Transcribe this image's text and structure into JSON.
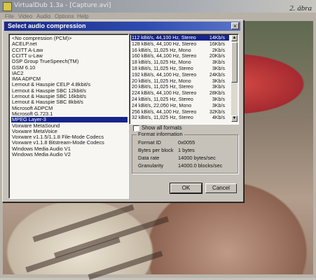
{
  "background_window": {
    "title": "VirtualDub 1.3a - [Capture.avi]",
    "menu": [
      "File",
      "Video",
      "Audio",
      "Options",
      "Help"
    ]
  },
  "page_caption": "2. ábra",
  "dialog": {
    "title": "Select audio compression",
    "close_label": "×",
    "codecs": [
      "<No compression (PCM)>",
      "ACELP.net",
      "CCITT A-Law",
      "CCITT u-Law",
      "DSP Group TrueSpeech(TM)",
      "GSM 6.10",
      "IAC2",
      "IMA ADPCM",
      "Lernout & Hauspie CELP 4.8kbit/s",
      "Lernout & Hauspie SBC 12kbit/s",
      "Lernout & Hauspie SBC 16kbit/s",
      "Lernout & Hauspie SBC 8kbit/s",
      "Microsoft ADPCM",
      "Microsoft G.723.1",
      "MPEG Layer-3",
      "Voxware MetaSound",
      "Voxware MetaVoice",
      "Voxware v1.1.5/1.1.8 File-Mode Codecs",
      "Voxware v1.1.8 Bitstream-Mode Codecs",
      "Windows Media Audio V1",
      "Windows Media Audio V2"
    ],
    "selected_codec_index": 14,
    "formats": [
      {
        "desc": "112 kBit/s, 44,100 Hz, Stereo",
        "rate": "14Kb/s"
      },
      {
        "desc": "128 kBit/s, 44,100 Hz, Stereo",
        "rate": "16Kb/s"
      },
      {
        "desc": "16 kBit/s, 11,025 Hz, Mono",
        "rate": "2Kb/s"
      },
      {
        "desc": "160 kBit/s, 44,100 Hz, Stereo",
        "rate": "20Kb/s"
      },
      {
        "desc": "18 kBit/s, 11,025 Hz, Mono",
        "rate": "3Kb/s"
      },
      {
        "desc": "18 kBit/s, 11,025 Hz, Stereo",
        "rate": "3Kb/s"
      },
      {
        "desc": "192 kBit/s, 44,100 Hz, Stereo",
        "rate": "24Kb/s"
      },
      {
        "desc": "20 kBit/s, 11,025 Hz, Mono",
        "rate": "3Kb/s"
      },
      {
        "desc": "20 kBit/s, 11,025 Hz, Stereo",
        "rate": "3Kb/s"
      },
      {
        "desc": "224 kBit/s, 44,100 Hz, Stereo",
        "rate": "28Kb/s"
      },
      {
        "desc": "24 kBit/s, 11,025 Hz, Stereo",
        "rate": "3Kb/s"
      },
      {
        "desc": "24 kBit/s, 22,050 Hz, Mono",
        "rate": "3Kb/s"
      },
      {
        "desc": "256 kBit/s, 44,100 Hz, Stereo",
        "rate": "32Kb/s"
      },
      {
        "desc": "32 kBit/s, 11,025 Hz, Stereo",
        "rate": "4Kb/s"
      }
    ],
    "selected_format_index": 0,
    "show_all_formats_label": "Show all formats",
    "show_all_formats_checked": false,
    "format_info": {
      "title": "Format information",
      "rows": [
        {
          "label": "Format ID",
          "value": "0x0055"
        },
        {
          "label": "Bytes per block",
          "value": "1 bytes"
        },
        {
          "label": "Data rate",
          "value": "14000 bytes/sec"
        },
        {
          "label": "Granularity",
          "value": "14000.0 blocks/sec"
        }
      ]
    },
    "ok_label": "OK",
    "cancel_label": "Cancel",
    "scroll_up_label": "▲",
    "scroll_down_label": "▼"
  },
  "colors": {
    "title_active": "#1b2a87",
    "selection": "#17248a",
    "dialog_face": "#c6c2ba"
  }
}
